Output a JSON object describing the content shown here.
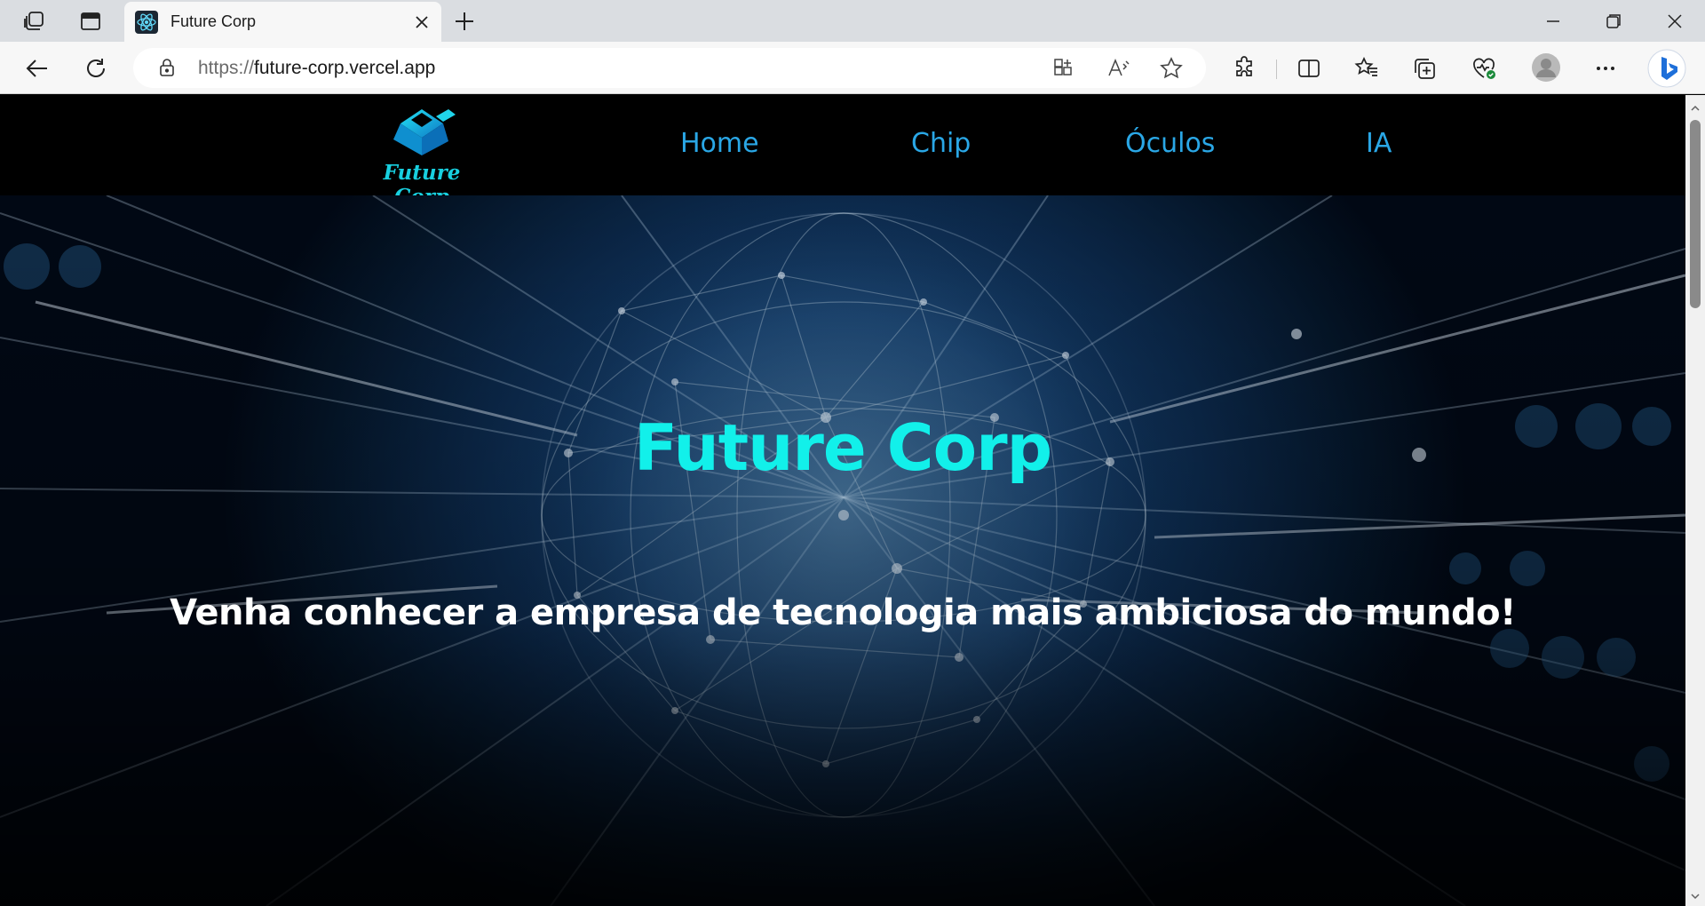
{
  "browser": {
    "tab": {
      "title": "Future Corp",
      "favicon": "react-atom-icon"
    },
    "address_bar": {
      "scheme": "https://",
      "host": "future-corp.vercel.app"
    },
    "icons": [
      "workspaces-icon",
      "tab-actions-icon",
      "new-tab-icon",
      "back-icon",
      "refresh-icon",
      "lock-icon",
      "app-available-icon",
      "read-aloud-icon",
      "favorite-star-icon",
      "extensions-icon",
      "split-screen-icon",
      "favorites-icon",
      "collections-icon",
      "browser-essentials-icon",
      "profile-avatar-icon",
      "more-menu-icon",
      "bing-copilot-icon",
      "minimize-icon",
      "restore-icon",
      "close-icon"
    ]
  },
  "site": {
    "logo_text": "Future Corp",
    "nav": [
      {
        "label": "Home"
      },
      {
        "label": "Chip"
      },
      {
        "label": "Óculos"
      },
      {
        "label": "IA"
      }
    ],
    "hero": {
      "title": "Future Corp",
      "subtitle": "Venha conhecer a empresa de tecnologia mais ambiciosa do mundo!"
    }
  },
  "colors": {
    "nav_link": "#2aa7e6",
    "hero_title": "#12f0ea",
    "hero_subtitle": "#ffffff",
    "nav_background": "#000000",
    "logo": "#18d0e0"
  }
}
